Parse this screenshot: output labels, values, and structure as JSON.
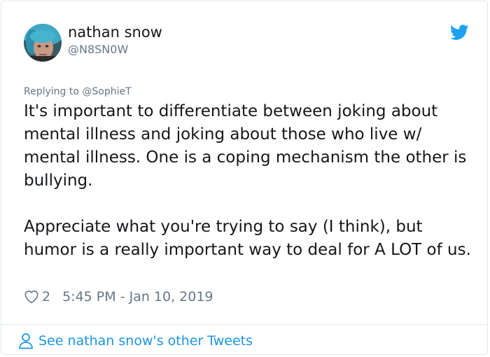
{
  "tweet": {
    "author_name": "nathan snow",
    "author_handle": "@N8SN0W",
    "replying_to": "Replying to @SophieT",
    "paragraphs": [
      "It's important to differentiate between joking about mental illness and joking about those who live w/ mental illness. One is a coping mechanism the other is bullying.",
      "Appreciate what you're trying to say (I think), but humor is a really important way to deal for A LOT of us."
    ],
    "like_count": "2",
    "timestamp": "5:45 PM - Jan 10, 2019"
  },
  "footer": {
    "link_label": "See nathan snow's other Tweets"
  },
  "icons": {
    "brand": "twitter-bird-icon",
    "like": "heart-icon",
    "profile": "person-icon"
  },
  "colors": {
    "text": "#14171a",
    "secondary": "#657786",
    "brand_blue": "#1da1f2",
    "link_blue": "#1b95e0",
    "border": "#e1e8ed"
  }
}
